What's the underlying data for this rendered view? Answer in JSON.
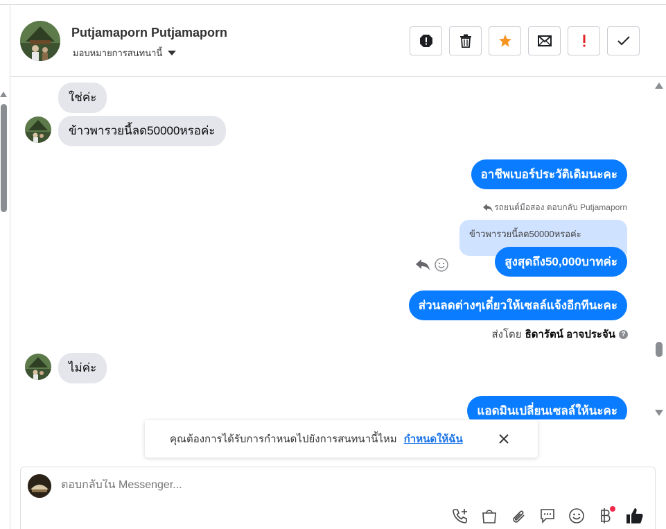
{
  "header": {
    "contact_name": "Putjamaporn Putjamaporn",
    "assign_label": "มอบหมายการสนทนานี้",
    "actions": [
      {
        "name": "spam",
        "icon": "octagon-alert-icon"
      },
      {
        "name": "delete",
        "icon": "trash-icon"
      },
      {
        "name": "star",
        "icon": "star-icon"
      },
      {
        "name": "mark-unread",
        "icon": "envelope-icon"
      },
      {
        "name": "follow-up",
        "icon": "exclamation-icon"
      },
      {
        "name": "done",
        "icon": "checkmark-icon"
      }
    ]
  },
  "messages": {
    "m1": "ใช่ค่ะ",
    "m2": "ข้าวพารวยนี้ลด50000หรอค่ะ",
    "m3": "อาชีพเบอร์ประวัติเดิมนะคะ",
    "reply_meta": "รถยนต์มือสอง ตอบกลับ Putjamaporn",
    "quoted": "ข้าวพารวยนี้ลด50000หรอค่ะ",
    "m4": "สูงสุดถึง50,000บาทค่ะ",
    "m5": "ส่วนลดต่างๆเดี๋ยวให้เซลล์แจ้งอีกทีนะคะ",
    "sent_by_prefix": "ส่งโดย",
    "sent_by_name": "ธิดารัตน์ อาจประจัน",
    "m6": "ไม่ค่ะ",
    "m7": "แอดมินเปลี่ยนเซลล์ให้นะคะ"
  },
  "toast": {
    "text": "คุณต้องการได้รับการกำหนดไปยังการสนทนานี้ไหม",
    "link": "กำหนดให้ฉัน"
  },
  "composer": {
    "placeholder": "ตอบกลับใน Messenger...",
    "tools": [
      "phone-plus-icon",
      "shopping-bag-icon",
      "paperclip-icon",
      "chat-bubble-icon",
      "smiley-icon",
      "baht-icon",
      "thumbs-up-icon"
    ]
  },
  "colors": {
    "outgoing": "#0a7cff",
    "incoming": "#e4e6eb",
    "star": "#f7931e",
    "alert": "#e02424",
    "link": "#1a73e8"
  }
}
